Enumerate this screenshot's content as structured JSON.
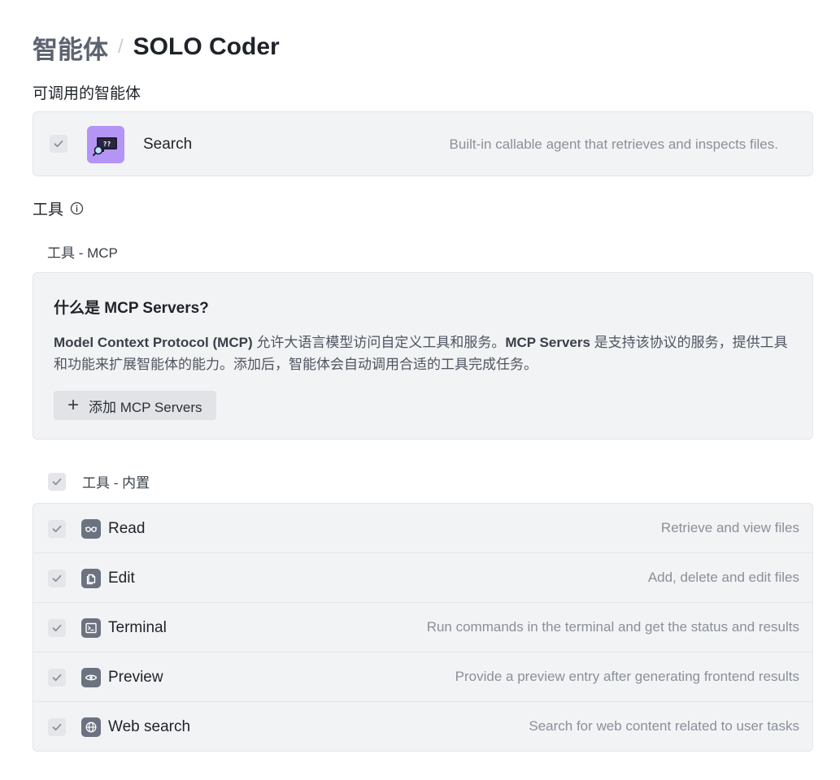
{
  "breadcrumb": {
    "root": "智能体",
    "separator": "/",
    "current": "SOLO Coder"
  },
  "agents_section": {
    "label": "可调用的智能体",
    "items": [
      {
        "name": "Search",
        "description": "Built-in callable agent that retrieves and inspects files.",
        "checked": true,
        "avatar_color": "#b495f5"
      }
    ]
  },
  "tools_section": {
    "label": "工具",
    "info_icon": "info-circle-icon",
    "mcp": {
      "label": "工具 - MCP",
      "card_title": "什么是 MCP Servers?",
      "description_parts": [
        "Model Context Protocol (MCP)",
        " 允许大语言模型访问自定义工具和服务。",
        "MCP Servers",
        " 是支持该协议的服务，提供工具和功能来扩展智能体的能力。添加后，智能体会自动调用合适的工具完成任务。"
      ],
      "add_button_label": "添加 MCP Servers",
      "add_button_icon": "plus-icon"
    },
    "builtin": {
      "label": "工具 - 内置",
      "checked": true,
      "items": [
        {
          "name": "Read",
          "description": "Retrieve and view files",
          "icon": "glasses-icon",
          "checked": true
        },
        {
          "name": "Edit",
          "description": "Add, delete and edit files",
          "icon": "file-copy-icon",
          "checked": true
        },
        {
          "name": "Terminal",
          "description": "Run commands in the terminal and get the status and results",
          "icon": "terminal-icon",
          "checked": true
        },
        {
          "name": "Preview",
          "description": "Provide a preview entry after generating frontend results",
          "icon": "eye-icon",
          "checked": true
        },
        {
          "name": "Web search",
          "description": "Search for web content related to user tasks",
          "icon": "globe-icon",
          "checked": true
        }
      ]
    }
  },
  "colors": {
    "card_bg": "#f2f3f5",
    "checkbox_bg": "#e4e6ea",
    "check_color": "#8a9099",
    "tool_icon_bg": "#6b7280",
    "muted_text": "#8a9099"
  }
}
